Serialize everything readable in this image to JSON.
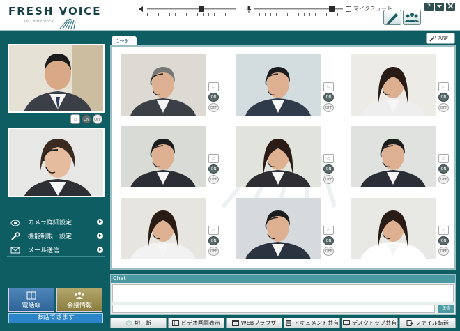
{
  "app": {
    "logo": "FRESH VOICE",
    "logo_sub": "TV Conference"
  },
  "header": {
    "mic_mute_label": "マイクミュート",
    "speaker_volume": 0.62,
    "mic_volume": 0.9
  },
  "self_view": {
    "onoff": {
      "off_label": "OFF",
      "on_label": "ON"
    }
  },
  "menu": {
    "items": [
      {
        "label": "カメラ詳細設定",
        "icon": "camera-icon"
      },
      {
        "label": "機能制限・設定",
        "icon": "wrench-icon"
      },
      {
        "label": "メール送信",
        "icon": "mail-icon"
      }
    ]
  },
  "bottom_left": {
    "phonebook_label": "電話帳",
    "meeting_info_label": "会議情報",
    "status_text": "お話できます"
  },
  "main": {
    "tab_label": "1〜9",
    "settings_label": "設定",
    "participants": [
      {
        "on": "ON",
        "off": "OFF"
      },
      {
        "on": "ON",
        "off": "OFF"
      },
      {
        "on": "ON",
        "off": "OFF"
      },
      {
        "on": "ON",
        "off": "OFF"
      },
      {
        "on": "ON",
        "off": "OFF"
      },
      {
        "on": "ON",
        "off": "OFF"
      },
      {
        "on": "ON",
        "off": "OFF"
      },
      {
        "on": "ON",
        "off": "OFF"
      },
      {
        "on": "ON",
        "off": "OFF"
      }
    ]
  },
  "chat": {
    "title": "Chat",
    "input_value": "",
    "send_label": "送信"
  },
  "toolbar": {
    "buttons": [
      {
        "label": "切　断",
        "icon": "disconnect-icon"
      },
      {
        "label": "ビデオ画面表示",
        "icon": "video-screen-icon"
      },
      {
        "label": "WEBブラウザ",
        "icon": "web-browser-icon"
      },
      {
        "label": "ドキュメント共有",
        "icon": "document-icon"
      },
      {
        "label": "デスクトップ共有",
        "icon": "desktop-icon"
      },
      {
        "label": "ファイル転送",
        "icon": "file-transfer-icon"
      }
    ]
  },
  "colors": {
    "background": "#0d5d63",
    "accent": "#2c84c9",
    "chat_header": "#4c9aa1"
  }
}
